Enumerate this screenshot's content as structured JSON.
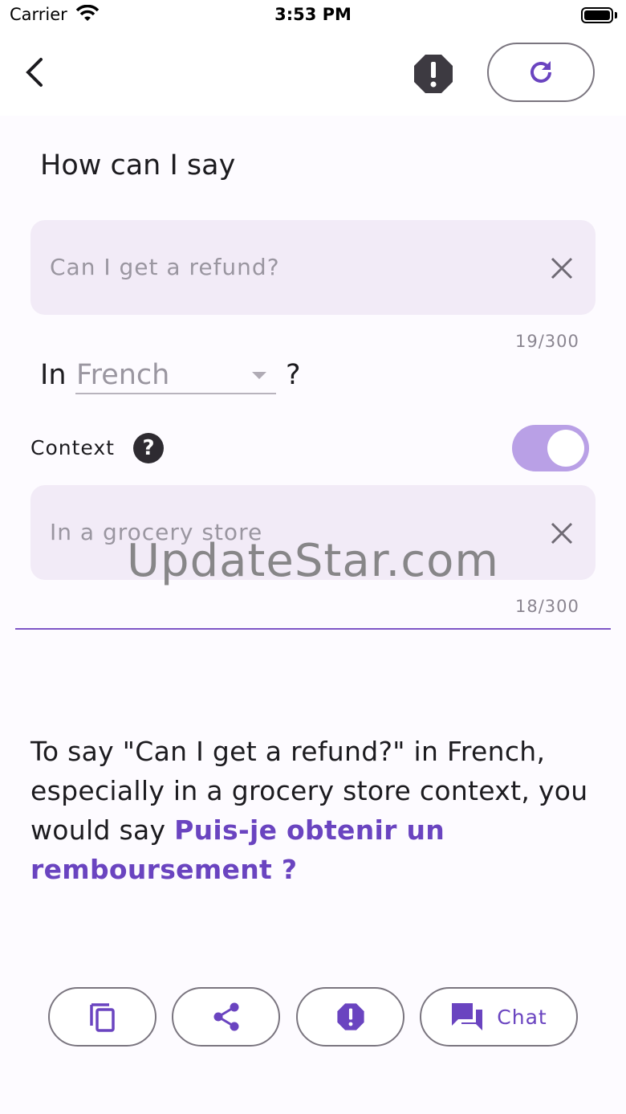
{
  "status_bar": {
    "carrier": "Carrier",
    "time": "3:53 PM"
  },
  "app_bar": {
    "back_icon": "chevron-left-icon",
    "report_icon": "alert-octagon-icon",
    "refresh_icon": "refresh-icon"
  },
  "heading": "How can I say",
  "phrase_field": {
    "placeholder": "Can I get a refund?",
    "counter": "19/300",
    "clear_icon": "close-icon"
  },
  "language": {
    "prefix": "In",
    "selected": "French",
    "suffix": "?"
  },
  "context": {
    "label": "Context",
    "help_icon": "help-circle-icon",
    "enabled": true
  },
  "context_field": {
    "placeholder": "In a grocery store",
    "counter": "18/300",
    "clear_icon": "close-icon"
  },
  "watermark": "UpdateStar.com",
  "result": {
    "intro": "To say \"Can I get a refund?\" in French, especially in a grocery store context, you would say ",
    "translation": "Puis-je obtenir un remboursement ?"
  },
  "actions": {
    "copy_icon": "copy-icon",
    "share_icon": "share-icon",
    "report_icon": "alert-octagon-icon",
    "chat_icon": "chat-icon",
    "chat_label": "Chat"
  },
  "colors": {
    "accent": "#6a44c0",
    "toggle_track": "#b9a0e6",
    "field_bg": "#f2ebf7"
  }
}
